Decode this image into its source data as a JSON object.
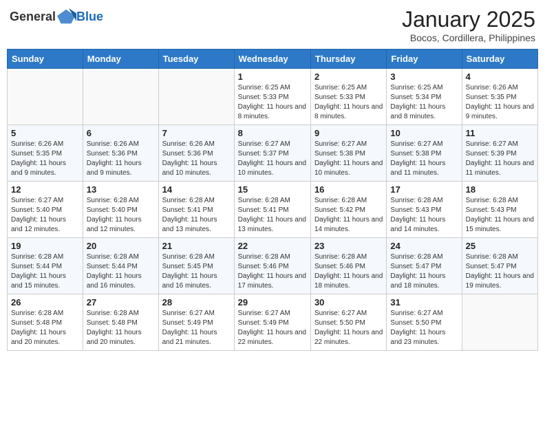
{
  "header": {
    "logo_general": "General",
    "logo_blue": "Blue",
    "month_title": "January 2025",
    "subtitle": "Bocos, Cordillera, Philippines"
  },
  "days_of_week": [
    "Sunday",
    "Monday",
    "Tuesday",
    "Wednesday",
    "Thursday",
    "Friday",
    "Saturday"
  ],
  "weeks": [
    [
      {
        "day": "",
        "info": ""
      },
      {
        "day": "",
        "info": ""
      },
      {
        "day": "",
        "info": ""
      },
      {
        "day": "1",
        "info": "Sunrise: 6:25 AM\nSunset: 5:33 PM\nDaylight: 11 hours and 8 minutes."
      },
      {
        "day": "2",
        "info": "Sunrise: 6:25 AM\nSunset: 5:33 PM\nDaylight: 11 hours and 8 minutes."
      },
      {
        "day": "3",
        "info": "Sunrise: 6:25 AM\nSunset: 5:34 PM\nDaylight: 11 hours and 8 minutes."
      },
      {
        "day": "4",
        "info": "Sunrise: 6:26 AM\nSunset: 5:35 PM\nDaylight: 11 hours and 9 minutes."
      }
    ],
    [
      {
        "day": "5",
        "info": "Sunrise: 6:26 AM\nSunset: 5:35 PM\nDaylight: 11 hours and 9 minutes."
      },
      {
        "day": "6",
        "info": "Sunrise: 6:26 AM\nSunset: 5:36 PM\nDaylight: 11 hours and 9 minutes."
      },
      {
        "day": "7",
        "info": "Sunrise: 6:26 AM\nSunset: 5:36 PM\nDaylight: 11 hours and 10 minutes."
      },
      {
        "day": "8",
        "info": "Sunrise: 6:27 AM\nSunset: 5:37 PM\nDaylight: 11 hours and 10 minutes."
      },
      {
        "day": "9",
        "info": "Sunrise: 6:27 AM\nSunset: 5:38 PM\nDaylight: 11 hours and 10 minutes."
      },
      {
        "day": "10",
        "info": "Sunrise: 6:27 AM\nSunset: 5:38 PM\nDaylight: 11 hours and 11 minutes."
      },
      {
        "day": "11",
        "info": "Sunrise: 6:27 AM\nSunset: 5:39 PM\nDaylight: 11 hours and 11 minutes."
      }
    ],
    [
      {
        "day": "12",
        "info": "Sunrise: 6:27 AM\nSunset: 5:40 PM\nDaylight: 11 hours and 12 minutes."
      },
      {
        "day": "13",
        "info": "Sunrise: 6:28 AM\nSunset: 5:40 PM\nDaylight: 11 hours and 12 minutes."
      },
      {
        "day": "14",
        "info": "Sunrise: 6:28 AM\nSunset: 5:41 PM\nDaylight: 11 hours and 13 minutes."
      },
      {
        "day": "15",
        "info": "Sunrise: 6:28 AM\nSunset: 5:41 PM\nDaylight: 11 hours and 13 minutes."
      },
      {
        "day": "16",
        "info": "Sunrise: 6:28 AM\nSunset: 5:42 PM\nDaylight: 11 hours and 14 minutes."
      },
      {
        "day": "17",
        "info": "Sunrise: 6:28 AM\nSunset: 5:43 PM\nDaylight: 11 hours and 14 minutes."
      },
      {
        "day": "18",
        "info": "Sunrise: 6:28 AM\nSunset: 5:43 PM\nDaylight: 11 hours and 15 minutes."
      }
    ],
    [
      {
        "day": "19",
        "info": "Sunrise: 6:28 AM\nSunset: 5:44 PM\nDaylight: 11 hours and 15 minutes."
      },
      {
        "day": "20",
        "info": "Sunrise: 6:28 AM\nSunset: 5:44 PM\nDaylight: 11 hours and 16 minutes."
      },
      {
        "day": "21",
        "info": "Sunrise: 6:28 AM\nSunset: 5:45 PM\nDaylight: 11 hours and 16 minutes."
      },
      {
        "day": "22",
        "info": "Sunrise: 6:28 AM\nSunset: 5:46 PM\nDaylight: 11 hours and 17 minutes."
      },
      {
        "day": "23",
        "info": "Sunrise: 6:28 AM\nSunset: 5:46 PM\nDaylight: 11 hours and 18 minutes."
      },
      {
        "day": "24",
        "info": "Sunrise: 6:28 AM\nSunset: 5:47 PM\nDaylight: 11 hours and 18 minutes."
      },
      {
        "day": "25",
        "info": "Sunrise: 6:28 AM\nSunset: 5:47 PM\nDaylight: 11 hours and 19 minutes."
      }
    ],
    [
      {
        "day": "26",
        "info": "Sunrise: 6:28 AM\nSunset: 5:48 PM\nDaylight: 11 hours and 20 minutes."
      },
      {
        "day": "27",
        "info": "Sunrise: 6:28 AM\nSunset: 5:48 PM\nDaylight: 11 hours and 20 minutes."
      },
      {
        "day": "28",
        "info": "Sunrise: 6:27 AM\nSunset: 5:49 PM\nDaylight: 11 hours and 21 minutes."
      },
      {
        "day": "29",
        "info": "Sunrise: 6:27 AM\nSunset: 5:49 PM\nDaylight: 11 hours and 22 minutes."
      },
      {
        "day": "30",
        "info": "Sunrise: 6:27 AM\nSunset: 5:50 PM\nDaylight: 11 hours and 22 minutes."
      },
      {
        "day": "31",
        "info": "Sunrise: 6:27 AM\nSunset: 5:50 PM\nDaylight: 11 hours and 23 minutes."
      },
      {
        "day": "",
        "info": ""
      }
    ]
  ]
}
